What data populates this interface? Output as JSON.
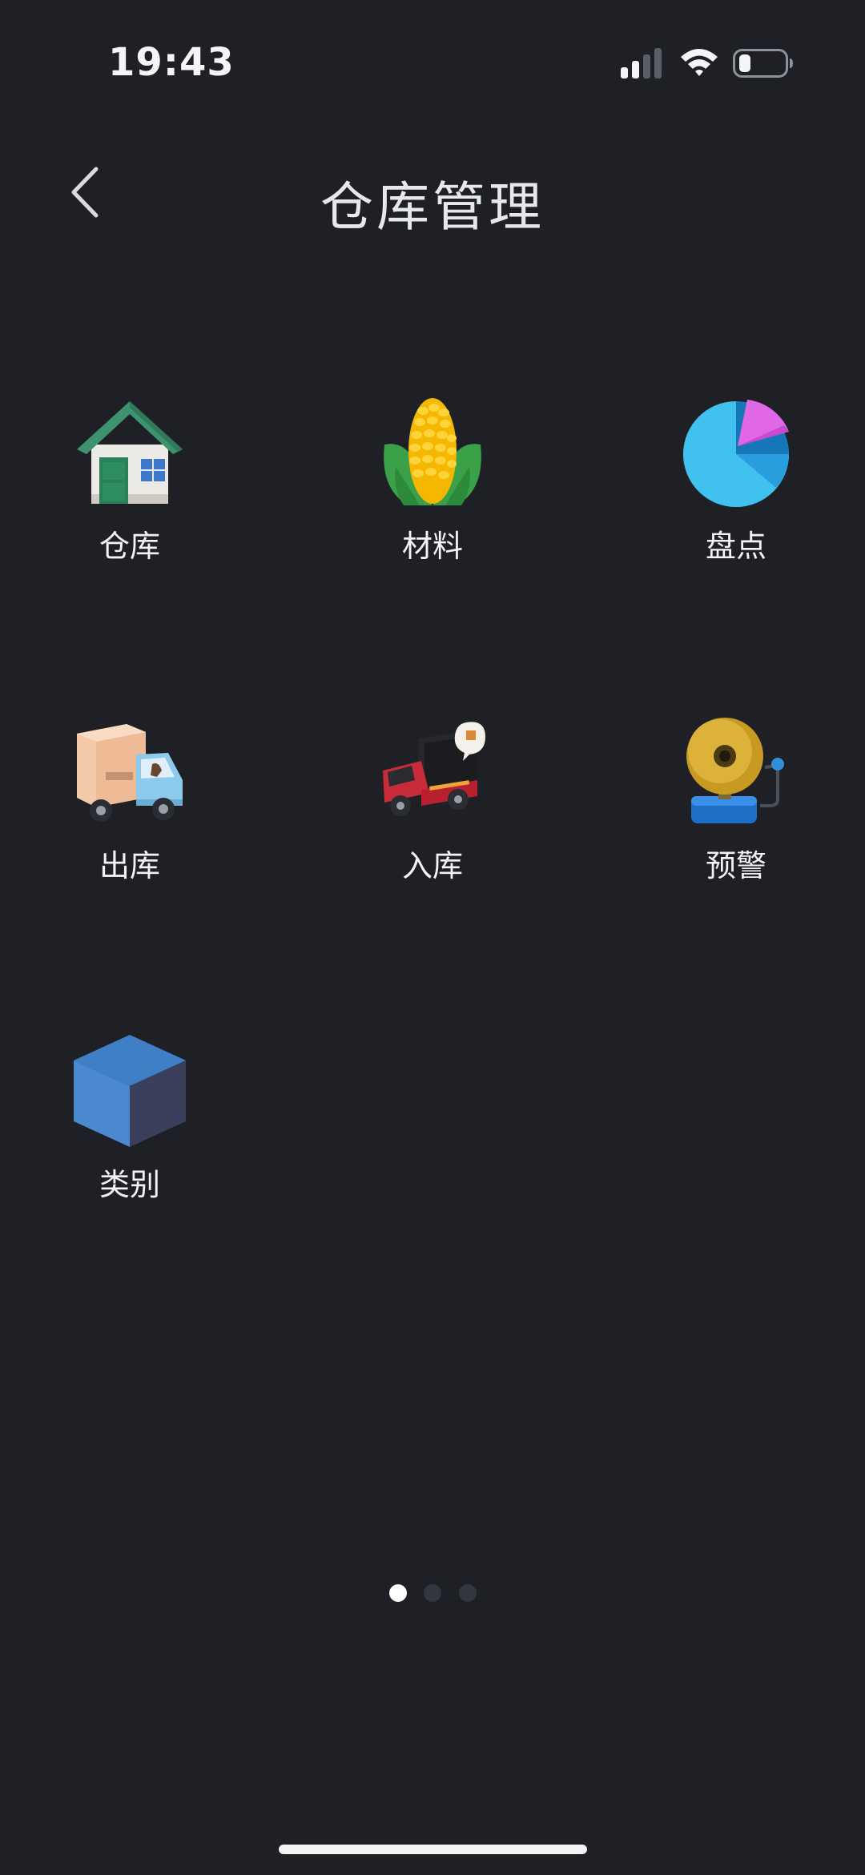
{
  "status_bar": {
    "time": "19:43"
  },
  "nav": {
    "title": "仓库管理"
  },
  "grid": {
    "items": [
      {
        "label": "仓库",
        "icon": "house-icon"
      },
      {
        "label": "材料",
        "icon": "corn-icon"
      },
      {
        "label": "盘点",
        "icon": "pie-chart-icon"
      },
      {
        "label": "出库",
        "icon": "delivery-truck-icon"
      },
      {
        "label": "入库",
        "icon": "cargo-truck-icon"
      },
      {
        "label": "预警",
        "icon": "alarm-bell-icon"
      },
      {
        "label": "类别",
        "icon": "cube-icon"
      }
    ]
  },
  "pager": {
    "total_pages": 3,
    "current_page": 1
  },
  "colors": {
    "background": "#1e2026",
    "text": "#f2f3f5",
    "dot_active": "#ffffff",
    "dot_inactive": "#32363d"
  }
}
